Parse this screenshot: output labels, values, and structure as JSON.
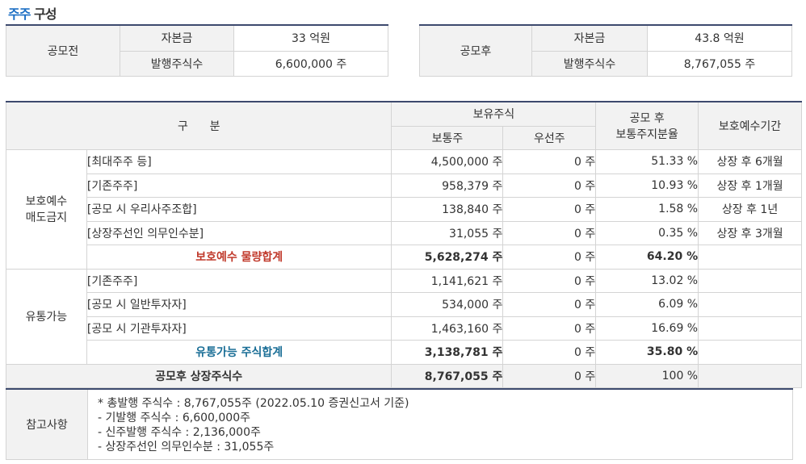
{
  "section_title": {
    "part1": "주주",
    "part2": "구성"
  },
  "before": {
    "label": "공모전",
    "capital_label": "자본금",
    "capital_value": "33 억원",
    "shares_label": "발행주식수",
    "shares_value": "6,600,000 주"
  },
  "after": {
    "label": "공모후",
    "capital_label": "자본금",
    "capital_value": "43.8 억원",
    "shares_label": "발행주식수",
    "shares_value": "8,767,055 주"
  },
  "main": {
    "headers": {
      "category": "구      분",
      "held": "보유주식",
      "common": "보통주",
      "preferred": "우선주",
      "share_line1": "공모 후",
      "share_line2": "보통주지분율",
      "lockup": "보호예수기간"
    },
    "group1": {
      "label_line1": "보호예수",
      "label_line2": "매도금지",
      "rows": [
        {
          "name": "[최대주주 등]",
          "common": "4,500,000 주",
          "preferred": "0 주",
          "ratio": "51.33 %",
          "period": "상장 후 6개월"
        },
        {
          "name": "[기존주주]",
          "common": "958,379 주",
          "preferred": "0 주",
          "ratio": "10.93 %",
          "period": "상장 후 1개월"
        },
        {
          "name": "[공모 시 우리사주조합]",
          "common": "138,840 주",
          "preferred": "0 주",
          "ratio": "1.58 %",
          "period": "상장 후 1년"
        },
        {
          "name": "[상장주선인 의무인수분]",
          "common": "31,055 주",
          "preferred": "0 주",
          "ratio": "0.35 %",
          "period": "상장 후 3개월"
        }
      ],
      "subtotal": {
        "name": "보호예수 물량합계",
        "common": "5,628,274 주",
        "preferred": "0 주",
        "ratio": "64.20 %"
      }
    },
    "group2": {
      "label": "유통가능",
      "rows": [
        {
          "name": "[기존주주]",
          "common": "1,141,621 주",
          "preferred": "0 주",
          "ratio": "13.02 %"
        },
        {
          "name": "[공모 시 일반투자자]",
          "common": "534,000 주",
          "preferred": "0 주",
          "ratio": "6.09 %"
        },
        {
          "name": "[공모 시 기관투자자]",
          "common": "1,463,160 주",
          "preferred": "0 주",
          "ratio": "16.69 %"
        }
      ],
      "subtotal": {
        "name": "유통가능 주식합계",
        "common": "3,138,781 주",
        "preferred": "0 주",
        "ratio": "35.80 %"
      }
    },
    "total": {
      "name": "공모후 상장주식수",
      "common": "8,767,055 주",
      "preferred": "0 주",
      "ratio": "100 %"
    }
  },
  "notes": {
    "label": "참고사항",
    "lines": [
      "* 총발행 주식수 : 8,767,055주 (2022.05.10 증권신고서 기준)",
      "- 기발행 주식수 : 6,600,000주",
      "- 신주발행 주식수 : 2,136,000주",
      "- 상장주선인 의무인수분 : 31,055주"
    ]
  }
}
